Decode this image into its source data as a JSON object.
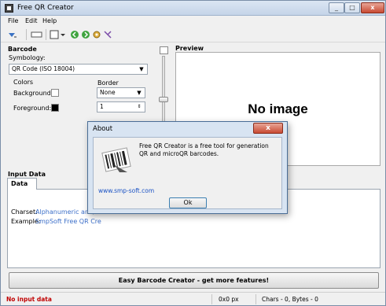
{
  "window": {
    "title": "Free QR Creator"
  },
  "menu": [
    "File",
    "Edit",
    "Help"
  ],
  "toolbar_icons": [
    "arrow-down-icon",
    "rectangle-icon",
    "barcode-icon",
    "back-icon",
    "forward-icon",
    "settings-icon",
    "info-icon"
  ],
  "barcode_panel": {
    "title": "Barcode",
    "symbology_label": "Symbology:",
    "symbology_value": "QR Code (ISO 18004)",
    "colors_label": "Colors",
    "background_label": "Background:",
    "foreground_label": "Foreground:",
    "background_color": "#ffffff",
    "foreground_color": "#000000",
    "border_label": "Border",
    "border_value": "None",
    "border_size": "1"
  },
  "preview": {
    "title": "Preview",
    "placeholder": "No image"
  },
  "input": {
    "title": "Input Data",
    "tab_label": "Data",
    "charset_label": "Charset:",
    "charset_value": "Alphanumeric and/or",
    "example_label": "Example:",
    "example_value": "SmpSoft Free QR Cre"
  },
  "promo_button": "Easy Barcode Creator - get more features!",
  "status": {
    "message": "No input data",
    "size": "0x0 px",
    "counts": "Chars - 0, Bytes - 0"
  },
  "about_dialog": {
    "title": "About",
    "close_label": "x",
    "description": "Free QR Creator is a free tool for generation QR and microQR barcodes.",
    "website": "www.smp-soft.com",
    "ok_label": "Ok"
  },
  "colors": {
    "status_error": "#c00000",
    "link": "#3c6fc9",
    "accent": "#4a6d96"
  }
}
